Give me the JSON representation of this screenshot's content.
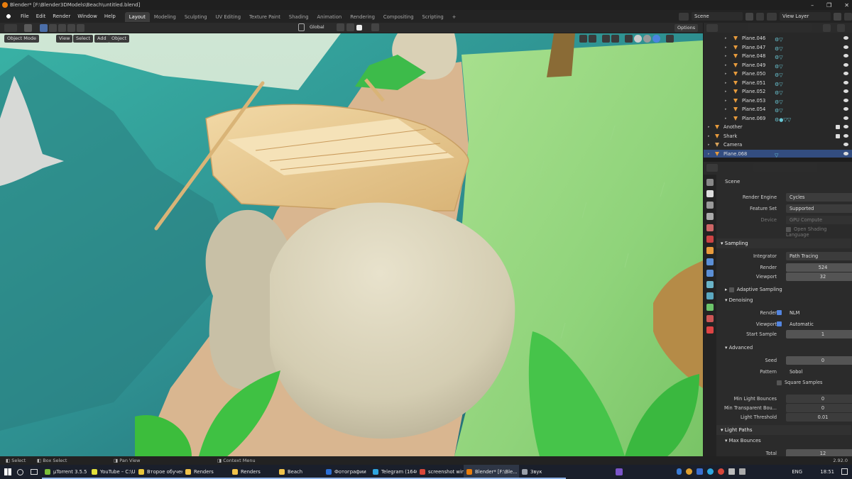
{
  "window": {
    "title": "Blender* [F:\\Blender3DModels\\Beach\\untitled.blend]",
    "minimize": "–",
    "maximize": "❐",
    "close": "✕"
  },
  "menu": [
    "File",
    "Edit",
    "Render",
    "Window",
    "Help"
  ],
  "workspaces": [
    "Layout",
    "Modeling",
    "Sculpting",
    "UV Editing",
    "Texture Paint",
    "Shading",
    "Animation",
    "Rendering",
    "Compositing",
    "Scripting"
  ],
  "add_workspace": "+",
  "scene": {
    "name": "Scene",
    "view_layer": "View Layer"
  },
  "viewport": {
    "mode": "Object Mode",
    "menus": [
      "View",
      "Select",
      "Add",
      "Object"
    ],
    "orientation": "Global",
    "options": "Options"
  },
  "outliner": {
    "rows": [
      {
        "name": "Plane.046",
        "mods": "⚙▽"
      },
      {
        "name": "Plane.047",
        "mods": "⚙▽"
      },
      {
        "name": "Plane.048",
        "mods": "⚙▽"
      },
      {
        "name": "Plane.049",
        "mods": "⚙▽"
      },
      {
        "name": "Plane.050",
        "mods": "⚙▽"
      },
      {
        "name": "Plane.051",
        "mods": "⚙▽"
      },
      {
        "name": "Plane.052",
        "mods": "⚙▽"
      },
      {
        "name": "Plane.053",
        "mods": "⚙▽"
      },
      {
        "name": "Plane.054",
        "mods": "⚙▽"
      },
      {
        "name": "Plane.069",
        "mods": "⚙●▽▽"
      },
      {
        "name": "Another",
        "mods": ""
      },
      {
        "name": "Shark",
        "mods": ""
      },
      {
        "name": "Camera",
        "mods": ""
      },
      {
        "name": "Plane.068",
        "mods": "▽"
      }
    ]
  },
  "properties": {
    "context": "Scene",
    "render_engine_label": "Render Engine",
    "render_engine": "Cycles",
    "feature_set_label": "Feature Set",
    "feature_set": "Supported",
    "device_label": "Device",
    "device": "GPU Compute",
    "osl": "Open Shading Language",
    "sampling": "Sampling",
    "integrator_label": "Integrator",
    "integrator": "Path Tracing",
    "render_label": "Render",
    "render_samples": "524",
    "viewport_label": "Viewport",
    "viewport_samples": "32",
    "adaptive": "Adaptive Sampling",
    "denoising": "Denoising",
    "den_render_label": "Render",
    "den_render": "NLM",
    "den_viewport_label": "Viewport",
    "den_viewport": "Automatic",
    "start_sample_label": "Start Sample",
    "start_sample": "1",
    "advanced": "Advanced",
    "seed_label": "Seed",
    "seed": "0",
    "pattern_label": "Pattern",
    "pattern": "Sobol",
    "square": "Square Samples",
    "min_light_label": "Min Light Bounces",
    "min_light": "0",
    "min_trans_label": "Min Transparent Bou...",
    "min_trans": "0",
    "light_thr_label": "Light Threshold",
    "light_thr": "0.01",
    "light_paths": "Light Paths",
    "max_bounces": "Max Bounces",
    "total_label": "Total",
    "total": "12"
  },
  "status": {
    "select": "Select",
    "box_select": "Box Select",
    "pan": "Pan View",
    "context_menu": "Context Menu",
    "version": "2.92.0"
  },
  "taskbar": {
    "items": [
      {
        "label": "µTorrent 3.5.5 (...",
        "color": "#7bbf3a"
      },
      {
        "label": "YouTube – C:\\U...",
        "color": "#e2e03a"
      },
      {
        "label": "Второе обучен...",
        "color": "#e8c53a"
      },
      {
        "label": "Renders",
        "color": "#f0c24a"
      },
      {
        "label": "Renders",
        "color": "#f0c24a"
      },
      {
        "label": "Beach",
        "color": "#f0c24a"
      },
      {
        "label": "Фотографии",
        "color": "#2b6fd6"
      },
      {
        "label": "Telegram (16402)",
        "color": "#2ea6e0"
      },
      {
        "label": "screenshot win...",
        "color": "#d8473a"
      },
      {
        "label": "Blender* [F:\\Ble...",
        "color": "#e87d0d"
      },
      {
        "label": "Звук",
        "color": "#9aa0aa"
      }
    ],
    "lang": "ENG",
    "time": "18:51"
  }
}
